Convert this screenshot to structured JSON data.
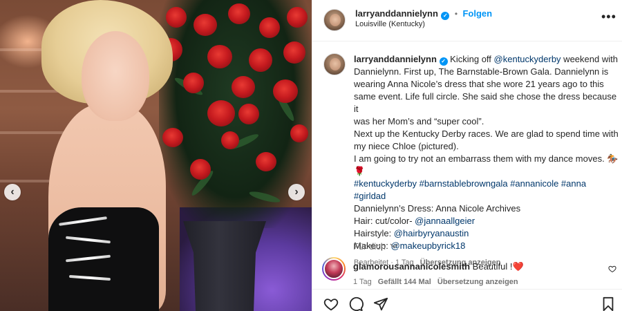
{
  "post": {
    "author": "larryanddannielynn",
    "follow_label": "Folgen",
    "separator": "•",
    "location": "Louisville (Kentucky)",
    "more_icon": "more-dots-icon"
  },
  "caption": {
    "author": "larryanddannielynn",
    "lines": [
      {
        "text_before": "Kicking off ",
        "mention": "@kentuckyderby",
        "text_after": " weekend with"
      },
      {
        "text": "Dannielynn. First up, The Barnstable-Brown Gala. Dannielynn is"
      },
      {
        "text": "wearing Anna Nicole’s dress that she wore 21 years ago to this"
      },
      {
        "text": "same event. Life full circle. She said she chose the dress because it"
      },
      {
        "text": "was her Mom’s and “super cool”."
      },
      {
        "text": "Next up the Kentucky Derby races. We are glad to spend time with"
      },
      {
        "text": "my niece Chloe (pictured)."
      },
      {
        "text": "I am going to try not an embarrass them with my dance moves. 🏇"
      },
      {
        "text": "🌹"
      }
    ],
    "hashtags": "#kentuckyderby #barnstablebrowngala #annanicole #anna #girldad",
    "credits": [
      {
        "label": "Dannielynn’s Dress: Anna Nicole Archives",
        "mention": ""
      },
      {
        "label": "Hair: cut/color- ",
        "mention": "@jannaallgeier"
      },
      {
        "label": "Hairstyle: ",
        "mention": "@hairbyryanaustin"
      },
      {
        "label": "Makeup: ",
        "mention": "@makeupbyrick18"
      }
    ],
    "meta": {
      "edited": "Bearbeitet",
      "dot": "·",
      "time": "1 Tag",
      "translate": "Übersetzung anzeigen"
    }
  },
  "see_translation": "Für dich",
  "comment": {
    "author": "glamorousannanicolesmith",
    "text": "Beautiful !",
    "emoji": "❤️",
    "time": "1 Tag",
    "likes": "Gefällt 144 Mal",
    "translate": "Übersetzung anzeigen"
  },
  "colors": {
    "accent_blue": "#0095f6",
    "link_blue": "#00376b",
    "muted_gray": "#737373",
    "heart_red": "#ed4956"
  },
  "icons": [
    "chevron-left-icon",
    "chevron-right-icon",
    "verified-badge-icon",
    "more-dots-icon",
    "chevron-down-icon",
    "heart-icon",
    "comment-icon",
    "share-icon",
    "bookmark-icon"
  ]
}
